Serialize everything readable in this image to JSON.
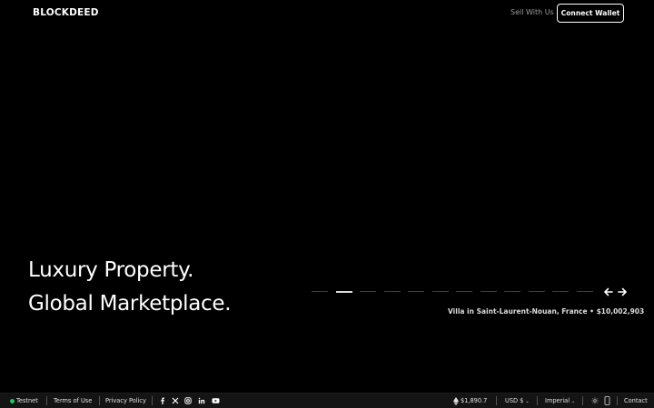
{
  "header": {
    "logo": "BLOCKDEED",
    "sell_link": "Sell With Us",
    "connect_button": "Connect Wallet"
  },
  "hero": {
    "line1": "Luxury Property.",
    "line2": "Global Marketplace.",
    "slider": {
      "total_slides": 12,
      "active_index": 1,
      "caption": "Villa in Saint-Laurent-Nouan, France • $10,002,903"
    }
  },
  "footer": {
    "network": "Testnet",
    "network_color": "#22c55e",
    "terms": "Terms of Use",
    "privacy": "Privacy Policy",
    "social_icons": [
      "facebook-icon",
      "x-icon",
      "instagram-icon",
      "linkedin-icon",
      "youtube-icon"
    ],
    "eth_price": "$1,890.7",
    "currency": "USD $",
    "units": "Imperial",
    "contact": "Contact"
  }
}
